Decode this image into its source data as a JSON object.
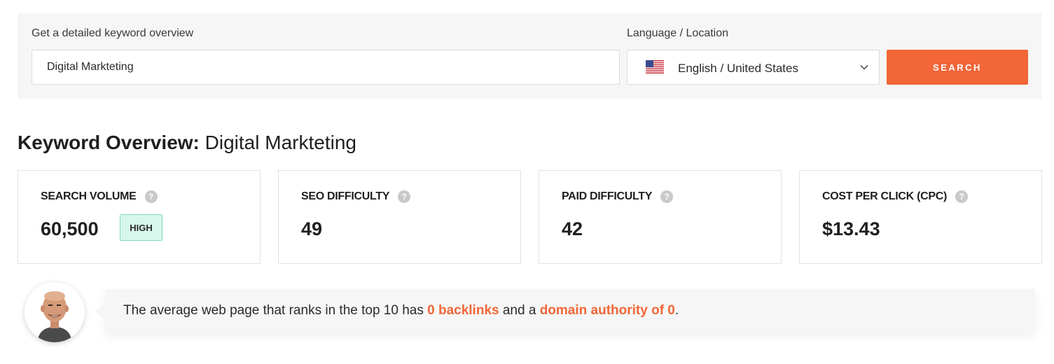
{
  "search": {
    "keyword_label": "Get a detailed keyword overview",
    "keyword_value": "Digital Markteting",
    "location_label": "Language / Location",
    "location_value": "English / United States",
    "button_label": "SEARCH"
  },
  "overview": {
    "title_prefix": "Keyword Overview:",
    "title_keyword": "Digital Markteting"
  },
  "metrics": [
    {
      "label": "SEARCH VOLUME",
      "value": "60,500",
      "badge": "HIGH"
    },
    {
      "label": "SEO DIFFICULTY",
      "value": "49"
    },
    {
      "label": "PAID DIFFICULTY",
      "value": "42"
    },
    {
      "label": "COST PER CLICK (CPC)",
      "value": "$13.43"
    }
  ],
  "help_glyph": "?",
  "tip": {
    "part1": "The average web page that ranks in the top 10 has ",
    "backlinks": "0 backlinks",
    "part2": " and a ",
    "authority": "domain authority of 0",
    "part3": "."
  },
  "icons": {
    "flag": "us-flag-icon",
    "chevron": "chevron-down-icon",
    "help": "help-icon",
    "avatar": "avatar"
  },
  "colors": {
    "accent": "#f26638",
    "badge_bg": "#d7f7ec",
    "badge_border": "#7fdcb8",
    "panel_bg": "#f5f6f5"
  }
}
